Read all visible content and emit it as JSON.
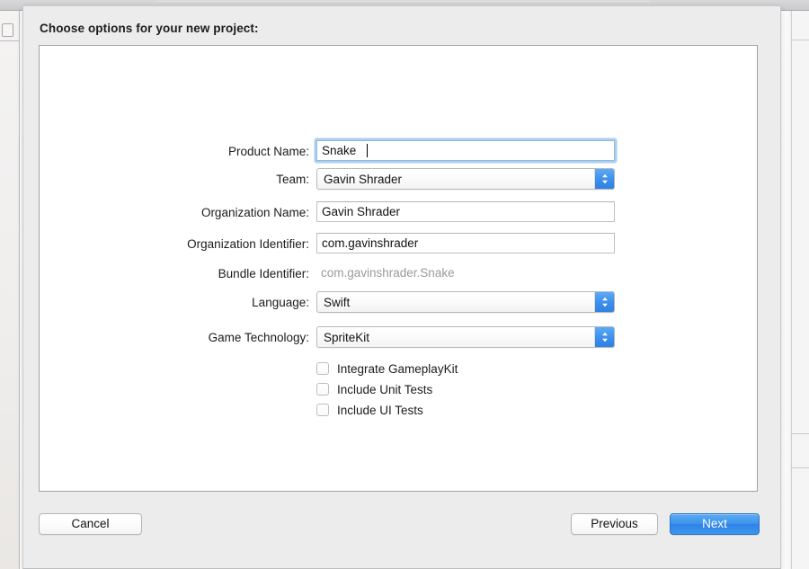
{
  "dialog": {
    "title": "Choose options for your new project:"
  },
  "form": {
    "fields": [
      {
        "label": "Product Name:",
        "type": "textfield",
        "value": "Snake",
        "placeholder": "",
        "focused": true,
        "name": "product-name"
      },
      {
        "label": "Team:",
        "type": "popup",
        "value": "Gavin Shrader",
        "name": "team"
      },
      {
        "label": "Organization Name:",
        "type": "textfield",
        "value": "Gavin Shrader",
        "placeholder": "",
        "focused": false,
        "name": "organization-name"
      },
      {
        "label": "Organization Identifier:",
        "type": "textfield",
        "value": "com.gavinshrader",
        "placeholder": "",
        "focused": false,
        "name": "organization-identifier"
      },
      {
        "label": "Bundle Identifier:",
        "type": "static",
        "value": "com.gavinshrader.Snake",
        "name": "bundle-identifier"
      },
      {
        "label": "Language:",
        "type": "popup",
        "value": "Swift",
        "name": "language"
      },
      {
        "label": "Game Technology:",
        "type": "popup",
        "value": "SpriteKit",
        "name": "game-technology"
      }
    ],
    "checkboxes": [
      {
        "label": "Integrate GameplayKit",
        "checked": false,
        "name": "integrate-gameplaykit"
      },
      {
        "label": "Include Unit Tests",
        "checked": false,
        "name": "include-unit-tests"
      },
      {
        "label": "Include UI Tests",
        "checked": false,
        "name": "include-ui-tests"
      }
    ]
  },
  "footer": {
    "cancel_label": "Cancel",
    "previous_label": "Previous",
    "next_label": "Next"
  },
  "colors": {
    "accent_blue": "#3d90ec",
    "focus_ring": "#6aa6e1",
    "sheet_background": "#ececec",
    "panel_background": "#ffffff",
    "static_text": "#9a9a9a"
  }
}
